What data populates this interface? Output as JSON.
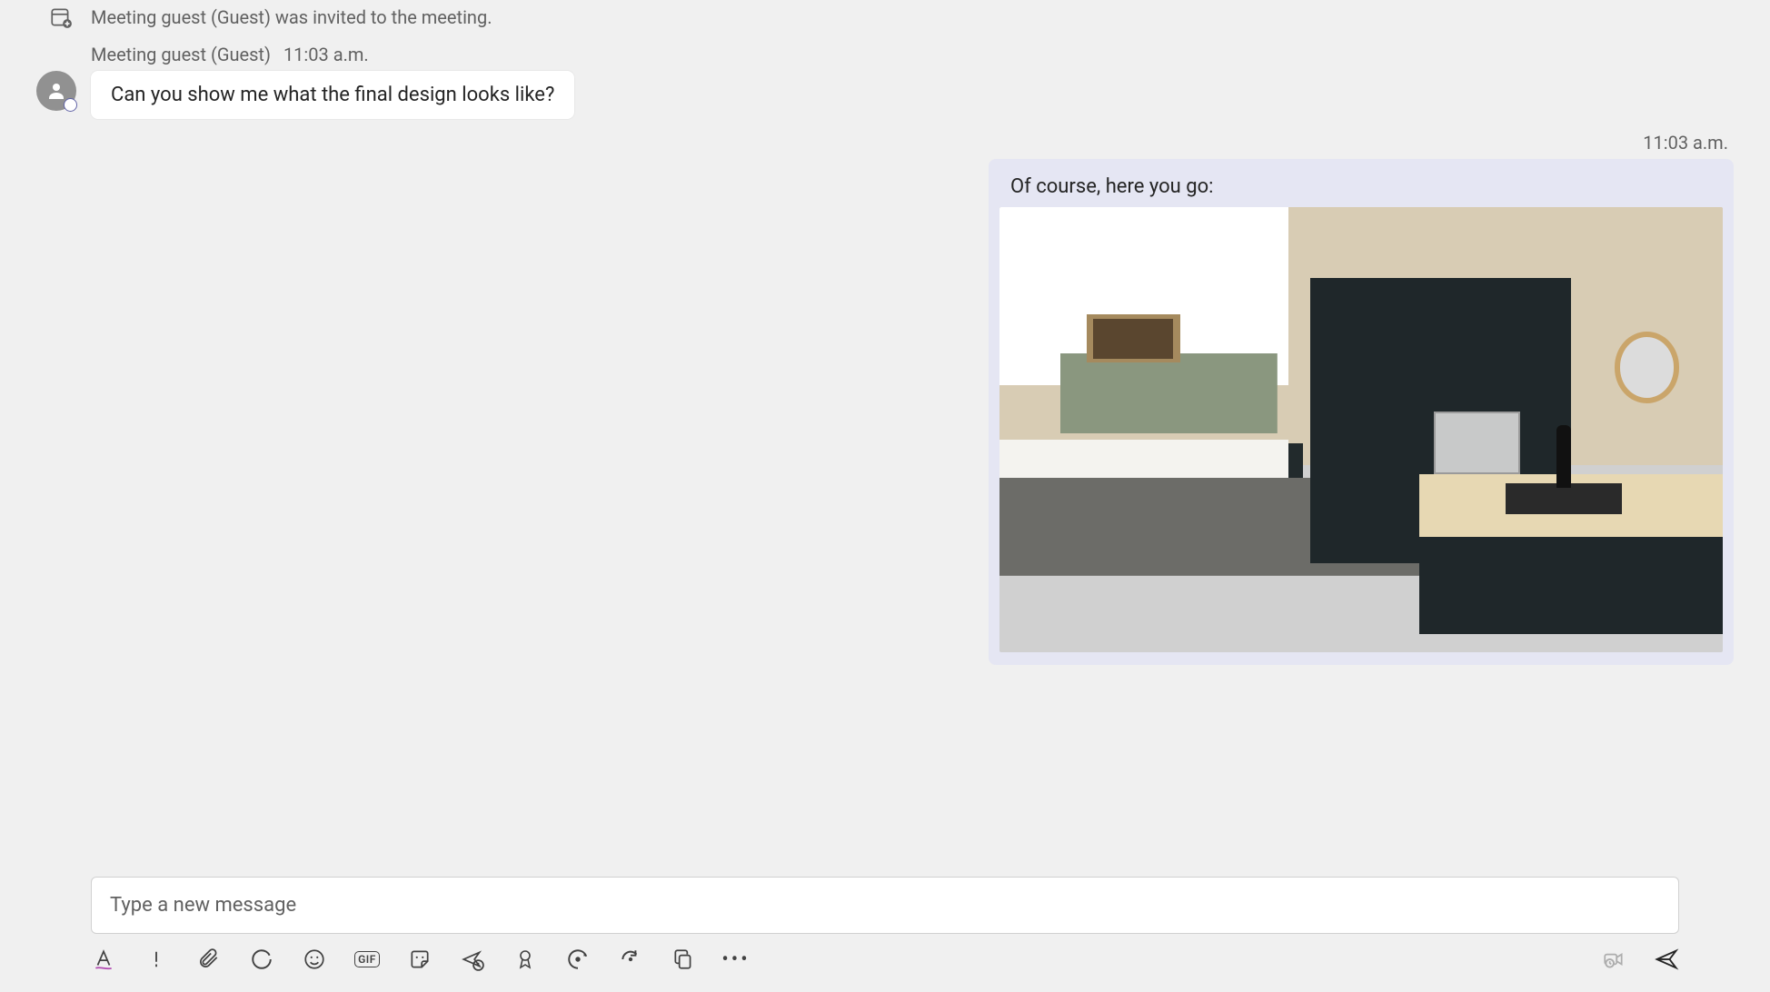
{
  "system_event": {
    "text": "Meeting guest (Guest) was invited to the meeting."
  },
  "incoming": {
    "sender": "Meeting guest (Guest)",
    "time": "11:03 a.m.",
    "body": "Can you show me what the final design looks like?"
  },
  "outgoing": {
    "time": "11:03 a.m.",
    "body": "Of course, here you go:",
    "attachment_desc": "modern kitchen interior render"
  },
  "composer": {
    "placeholder": "Type a new message"
  },
  "toolbar": {
    "gif_label": "GIF"
  }
}
